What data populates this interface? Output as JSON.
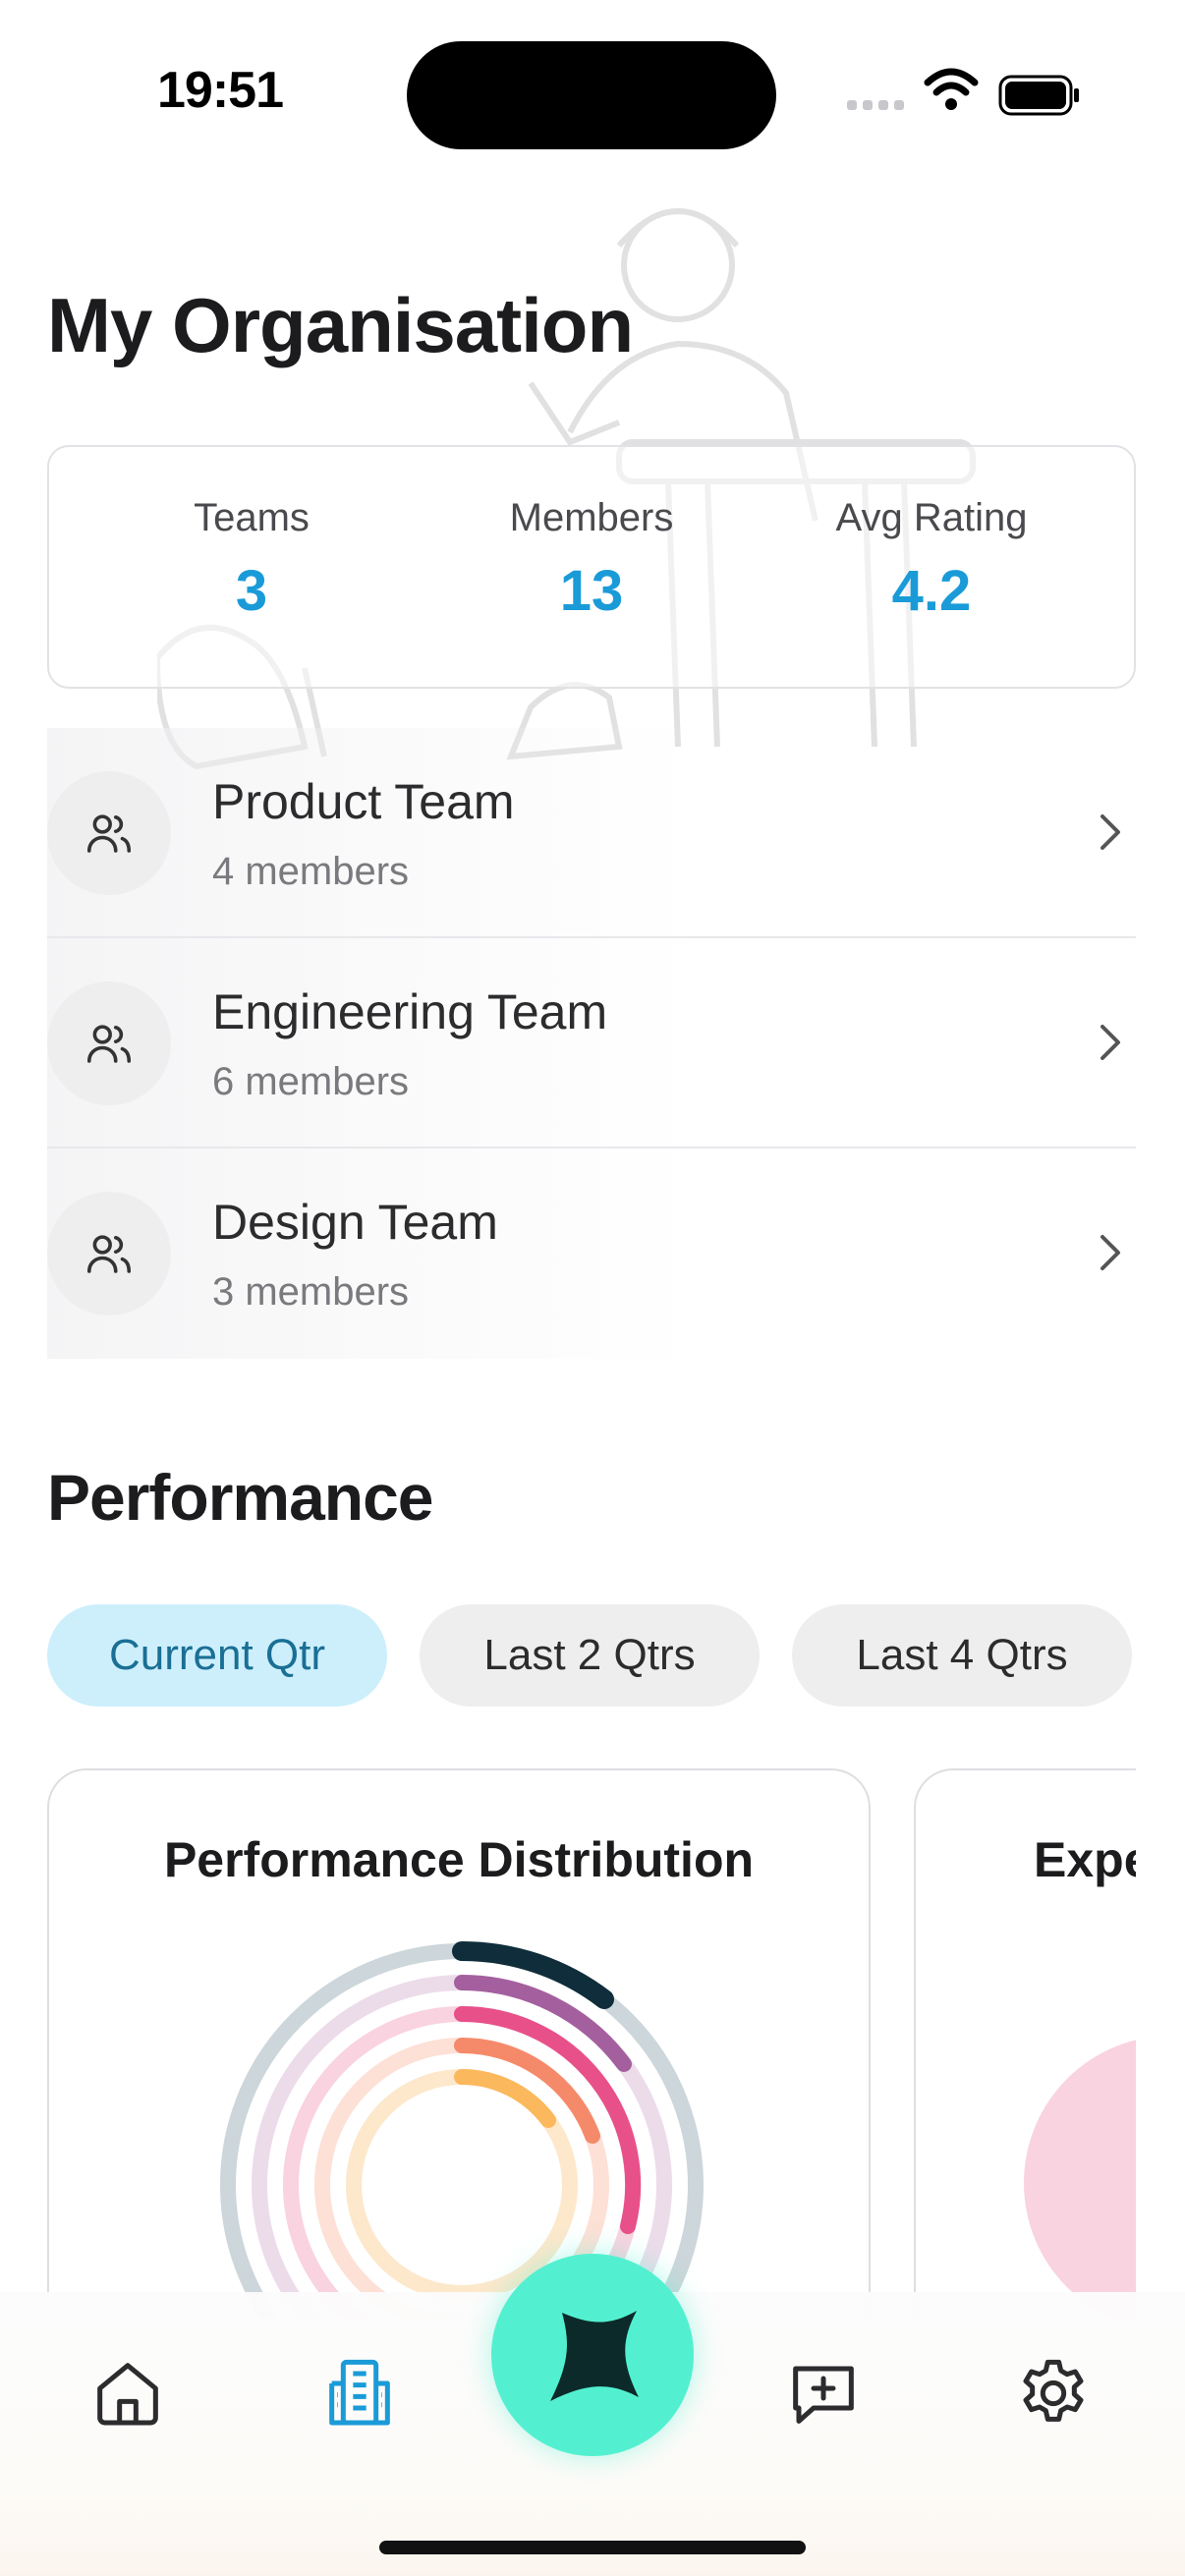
{
  "status_bar": {
    "time": "19:51"
  },
  "page": {
    "title": "My Organisation"
  },
  "stats": [
    {
      "label": "Teams",
      "value": "3"
    },
    {
      "label": "Members",
      "value": "13"
    },
    {
      "label": "Avg Rating",
      "value": "4.2"
    }
  ],
  "teams": [
    {
      "name": "Product Team",
      "members": "4 members"
    },
    {
      "name": "Engineering Team",
      "members": "6 members"
    },
    {
      "name": "Design Team",
      "members": "3 members"
    }
  ],
  "performance": {
    "title": "Performance",
    "filters": [
      "Current Qtr",
      "Last 2 Qtrs",
      "Last 4 Qtrs"
    ],
    "active_filter": "Current Qtr",
    "cards": [
      {
        "title": "Performance Distribution"
      },
      {
        "title": "Expe"
      }
    ]
  },
  "colors": {
    "accent": "#1a9bd8",
    "fab": "#52f0d0",
    "ring_colors": [
      "#0f2d3a",
      "#a45f9e",
      "#e8508a",
      "#f58a6a",
      "#fbb85c"
    ]
  },
  "tab_bar": {
    "items": [
      "home-icon",
      "organisation-icon",
      "ai-sparkle-icon",
      "feedback-icon",
      "settings-icon"
    ],
    "active": "organisation-icon"
  }
}
